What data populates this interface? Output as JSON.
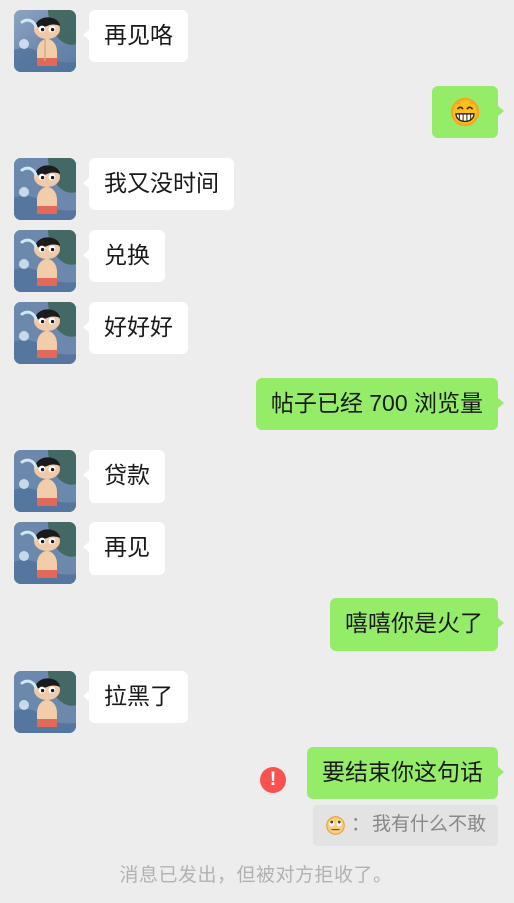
{
  "theme": {
    "background": "#ededed",
    "incoming_bubble": "#ffffff",
    "outgoing_bubble": "#95ec69",
    "quote_bubble": "#e3e3e3",
    "error_badge": "#fa5151",
    "text_primary": "#191919",
    "text_muted": "#b2b2b2"
  },
  "messages": [
    {
      "id": 1,
      "side": "left",
      "type": "text",
      "text": "再见咯",
      "avatar": "contact-avatar"
    },
    {
      "id": 2,
      "side": "right",
      "type": "emoji",
      "text": "😁",
      "emoji_name": "grinning-face-emoji"
    },
    {
      "id": 3,
      "side": "left",
      "type": "text",
      "text": "我又没时间",
      "avatar": "contact-avatar"
    },
    {
      "id": 4,
      "side": "left",
      "type": "text",
      "text": "兑换",
      "avatar": "contact-avatar"
    },
    {
      "id": 5,
      "side": "left",
      "type": "text",
      "text": "好好好",
      "avatar": "contact-avatar"
    },
    {
      "id": 6,
      "side": "right",
      "type": "text",
      "text": "帖子已经 700 浏览量"
    },
    {
      "id": 7,
      "side": "left",
      "type": "text",
      "text": "贷款",
      "avatar": "contact-avatar"
    },
    {
      "id": 8,
      "side": "left",
      "type": "text",
      "text": "再见",
      "avatar": "contact-avatar"
    },
    {
      "id": 9,
      "side": "right",
      "type": "text",
      "text": "嘻嘻你是火了"
    },
    {
      "id": 10,
      "side": "left",
      "type": "text",
      "text": "拉黑了",
      "avatar": "contact-avatar"
    },
    {
      "id": 11,
      "side": "right",
      "type": "text",
      "text": "要结束你这句话",
      "failed": true,
      "error_symbol": "!"
    }
  ],
  "quoted_reply": {
    "emoji_name": "face-with-rolling-eyes-emoji",
    "separator": "：",
    "text": "我有什么不敢"
  },
  "notice": {
    "text": "消息已发出，但被对方拒收了。"
  }
}
